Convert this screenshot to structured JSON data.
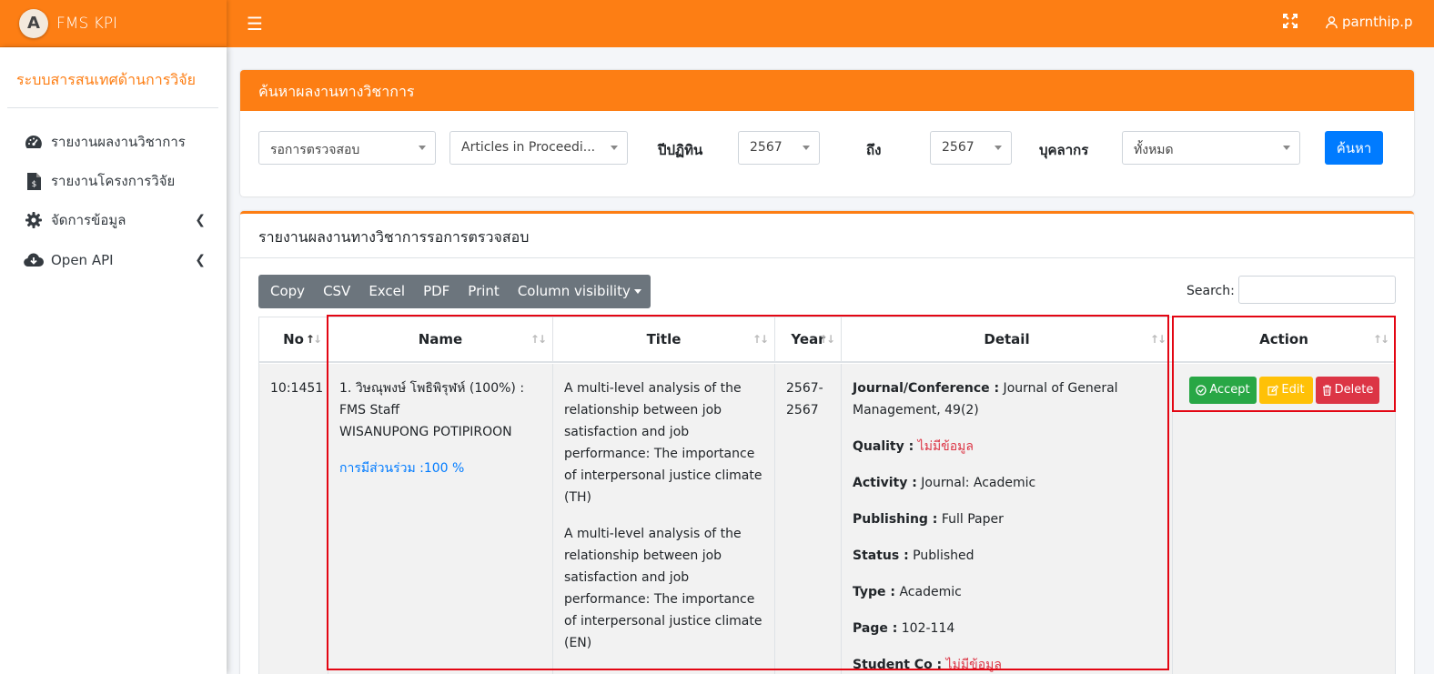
{
  "brand": {
    "logo_letter": "A",
    "name": "FMS KPI"
  },
  "header": {
    "user": "parnthip.p"
  },
  "sidebar": {
    "title": "ระบบสารสนเทศด้านการวิจัย",
    "items": [
      {
        "label": "รายงานผลงานวิชาการ",
        "icon": "dashboard-icon"
      },
      {
        "label": "รายงานโครงการวิจัย",
        "icon": "file-invoice-icon"
      },
      {
        "label": "จัดการข้อมูล",
        "icon": "gear-icon"
      },
      {
        "label": "Open API",
        "icon": "cloud-download-icon"
      }
    ]
  },
  "search_card": {
    "title": "ค้นหาผลงานทางวิชาการ",
    "status_select": "รอการตรวจสอบ",
    "type_select": "Articles in Proceedi...",
    "year_label": "ปีปฏิทิน",
    "year_from": "2567",
    "to_label": "ถึง",
    "year_to": "2567",
    "person_label": "บุคลากร",
    "person_select": "ทั้งหมด",
    "search_button": "ค้นหา"
  },
  "report": {
    "title": "รายงานผลงานทางวิชาการรอการตรวจสอบ",
    "buttons": [
      "Copy",
      "CSV",
      "Excel",
      "PDF",
      "Print"
    ],
    "column_visibility": "Column visibility",
    "search_label": "Search:",
    "columns": {
      "no": "No",
      "name": "Name",
      "title": "Title",
      "year": "Year",
      "detail": "Detail",
      "action": "Action"
    },
    "row": {
      "no": "10:1451",
      "name_line1_prefix": "1. ",
      "name_thai": "วิษณุพงษ์ โพธิพิรุฬห์",
      "name_line1_suffix": " (100%) :",
      "name_line2": "FMS Staff",
      "name_line3": "WISANUPONG POTIPIROON",
      "participation": "การมีส่วนร่วม :100 %",
      "title_th": "A multi-level analysis of the relationship between job satisfaction and job performance: The importance of interpersonal justice climate (TH)",
      "title_en": "A multi-level analysis of the relationship between job satisfaction and job performance: The importance of interpersonal justice climate (EN)",
      "year_line1": "2567-",
      "year_line2": "2567",
      "detail": {
        "journal_label": "Journal/Conference :",
        "journal_value": " Journal of General Management, 49(2)",
        "quality_label": "Quality :",
        "quality_value": " ไม่มีข้อมูล",
        "activity_label": "Activity :",
        "activity_value": " Journal: Academic",
        "publishing_label": "Publishing :",
        "publishing_value": " Full Paper",
        "status_label": "Status :",
        "status_value": " Published",
        "type_label": "Type :",
        "type_value": " Academic",
        "page_label": "Page :",
        "page_value": " 102-114",
        "student_label": "Student Co :",
        "student_value": " ไม่มีข้อมูล"
      },
      "actions": {
        "accept": "Accept",
        "edit": "Edit",
        "delete": "Delete"
      }
    }
  },
  "colors": {
    "primary": "#fd7e14",
    "blue": "#007bff",
    "success": "#28a745",
    "warning": "#ffc107",
    "danger": "#dc3545",
    "highlight": "#e30613"
  }
}
